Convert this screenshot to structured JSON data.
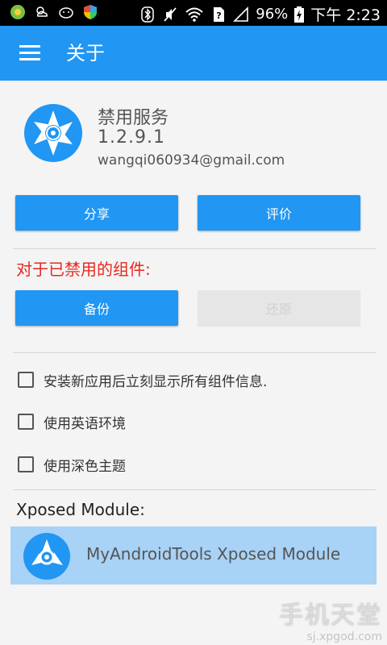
{
  "status_bar": {
    "battery": "96%",
    "time": "下午 2:23"
  },
  "app_bar": {
    "title": "关于"
  },
  "about": {
    "app_name": "禁用服务",
    "version": "1.2.9.1",
    "email": "wangqi060934@gmail.com"
  },
  "actions": {
    "share": "分享",
    "rate": "评价"
  },
  "disabled_components": {
    "heading": "对于已禁用的组件:",
    "backup": "备份",
    "restore": "还原"
  },
  "settings": {
    "items": [
      {
        "label": "安装新应用后立刻显示所有组件信息.",
        "checked": false
      },
      {
        "label": "使用英语环境",
        "checked": false
      },
      {
        "label": "使用深色主题",
        "checked": false
      }
    ]
  },
  "xposed": {
    "heading": "Xposed Module:",
    "module_name": "MyAndroidTools Xposed Module"
  },
  "watermark": {
    "site_cn": "手机天堂",
    "site_url": "sj.xpgod.com"
  },
  "colors": {
    "accent": "#2196f3",
    "warning": "#e8281e",
    "highlight": "#a8d2f6"
  }
}
